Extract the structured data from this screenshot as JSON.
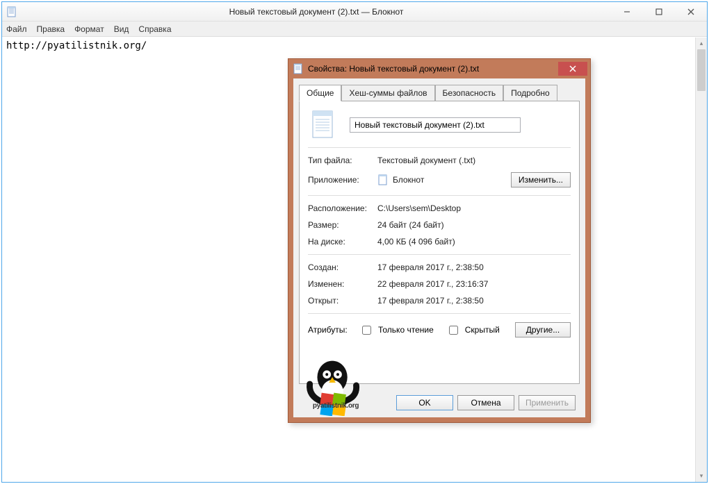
{
  "notepad": {
    "title": "Новый текстовый документ (2).txt — Блокнот",
    "menu": {
      "file": "Файл",
      "edit": "Правка",
      "format": "Формат",
      "view": "Вид",
      "help": "Справка"
    },
    "content": "http://pyatilistnik.org/"
  },
  "dialog": {
    "title": "Свойства: Новый текстовый документ (2).txt",
    "tabs": {
      "general": "Общие",
      "hashes": "Хеш-суммы файлов",
      "security": "Безопасность",
      "details": "Подробно"
    },
    "filename": "Новый текстовый документ (2).txt",
    "labels": {
      "filetype": "Тип файла:",
      "application": "Приложение:",
      "location": "Расположение:",
      "size": "Размер:",
      "ondisk": "На диске:",
      "created": "Создан:",
      "modified": "Изменен:",
      "accessed": "Открыт:",
      "attributes": "Атрибуты:",
      "readonly": "Только чтение",
      "hidden": "Скрытый"
    },
    "values": {
      "filetype": "Текстовый документ (.txt)",
      "application": "Блокнот",
      "location": "C:\\Users\\sem\\Desktop",
      "size": "24 байт (24 байт)",
      "ondisk": "4,00 КБ (4 096 байт)",
      "created": "17 февраля 2017 г., 2:38:50",
      "modified": "22 февраля 2017 г., 23:16:37",
      "accessed": "17 февраля 2017 г., 2:38:50"
    },
    "buttons": {
      "change": "Изменить...",
      "other": "Другие...",
      "ok": "OK",
      "cancel": "Отмена",
      "apply": "Применить"
    }
  },
  "watermark": {
    "text": "pyatilistnik.org"
  }
}
